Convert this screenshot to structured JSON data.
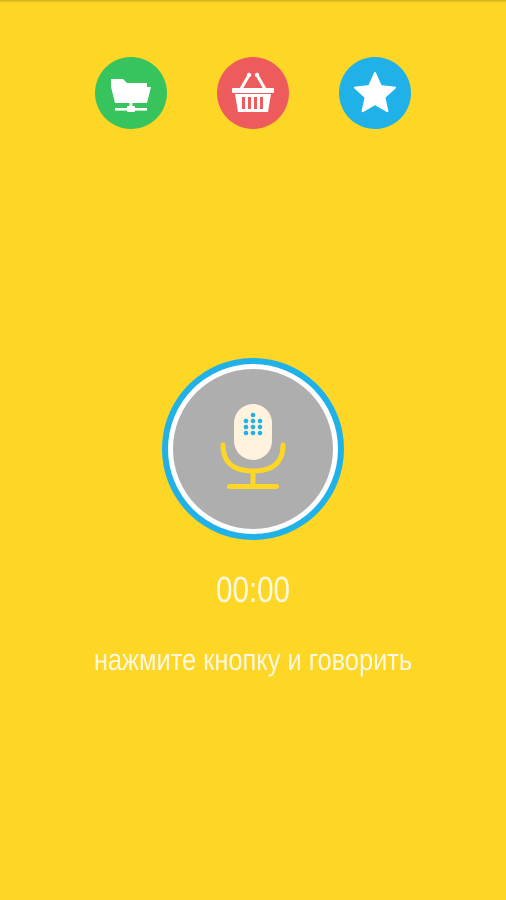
{
  "toolbar": {
    "buttons": [
      {
        "name": "files",
        "icon": "folder-network-icon",
        "color": "#37C45C"
      },
      {
        "name": "shop",
        "icon": "shopping-basket-icon",
        "color": "#EE5B5D"
      },
      {
        "name": "favorites",
        "icon": "star-icon",
        "color": "#1FB1E7"
      }
    ]
  },
  "recorder": {
    "icon": "microphone-icon",
    "ring_color": "#1FB1E7",
    "inner_color": "#AEAEAE",
    "mic_color": "#FDD626",
    "timer": "00:00",
    "hint": "нажмите кнопку и говорить"
  },
  "theme": {
    "background": "#FDD626",
    "text_color": "#FFF8E0"
  }
}
